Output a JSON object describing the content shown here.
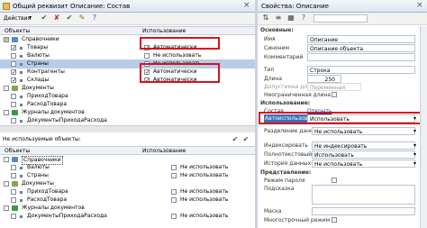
{
  "left_panel": {
    "title": "Общий реквизит Описание: Состав",
    "toolbar": {
      "actions_label": "Действия"
    },
    "columns": {
      "objects": "Объекты",
      "usage": "Использование"
    },
    "tree": [
      {
        "label": "Справочники",
        "usage": ""
      },
      {
        "label": "Товары",
        "usage": "Автоматически"
      },
      {
        "label": "Валюты",
        "usage": "Не использовать"
      },
      {
        "label": "Страны",
        "usage": "Не использовать"
      },
      {
        "label": "Контрагенты",
        "usage": "Автоматически"
      },
      {
        "label": "Склады",
        "usage": "Автоматически"
      },
      {
        "label": "Документы",
        "usage": ""
      },
      {
        "label": "ПриходТовара",
        "usage": ""
      },
      {
        "label": "РасходТовара",
        "usage": ""
      },
      {
        "label": "Журналы документов",
        "usage": ""
      },
      {
        "label": "ДокументыПриходаРасхода",
        "usage": ""
      }
    ],
    "unused_title": "Не используемые объекты:",
    "unused_tree": [
      {
        "label": "Справочники",
        "usage": ""
      },
      {
        "label": "Валюты",
        "usage": "Не использовать"
      },
      {
        "label": "Страны",
        "usage": "Не использовать"
      },
      {
        "label": "Документы",
        "usage": ""
      },
      {
        "label": "ПриходТовара",
        "usage": "Не использовать"
      },
      {
        "label": "РасходТовара",
        "usage": "Не использовать"
      },
      {
        "label": "Журналы документов",
        "usage": ""
      },
      {
        "label": "ДокументыПриходаРасхода",
        "usage": "Не использовать"
      }
    ]
  },
  "right_panel": {
    "title": "Свойства: Описание",
    "sections": {
      "main": "Основные:",
      "usage": "Использование:",
      "presentation": "Представление:"
    },
    "props": {
      "name_label": "Имя",
      "name_value": "Описание",
      "synonym_label": "Синоним",
      "synonym_value": "Описание объекта",
      "comment_label": "Комментарий",
      "type_label": "Тип",
      "type_value": "Строка",
      "length_label": "Длина",
      "length_value": "250",
      "allowed_length_label": "Допустимая длина",
      "allowed_length_value": "Переменная",
      "unlimited_label": "Неограниченная длина",
      "content_label": "Состав",
      "content_value": "Открыть",
      "autouse_label": "Автоиспользование",
      "autouse_value": "Использовать",
      "data_split_label": "Разделение данных",
      "data_split_value": "Не использовать",
      "indexing_label": "Индексировать",
      "indexing_value": "Не индексировать",
      "fulltext_label": "Полнотекстовый поиск",
      "fulltext_value": "Использовать",
      "history_label": "История данных",
      "history_value": "Не использовать",
      "password_mode_label": "Режим пароля",
      "hint_label": "Подсказка",
      "mask_label": "Маска",
      "multiline_label": "Многострочный режим"
    }
  },
  "colors": {
    "red_highlight": "#d8111c",
    "selection": "#b7cce8",
    "autouse_select": "#3f6fb5"
  }
}
